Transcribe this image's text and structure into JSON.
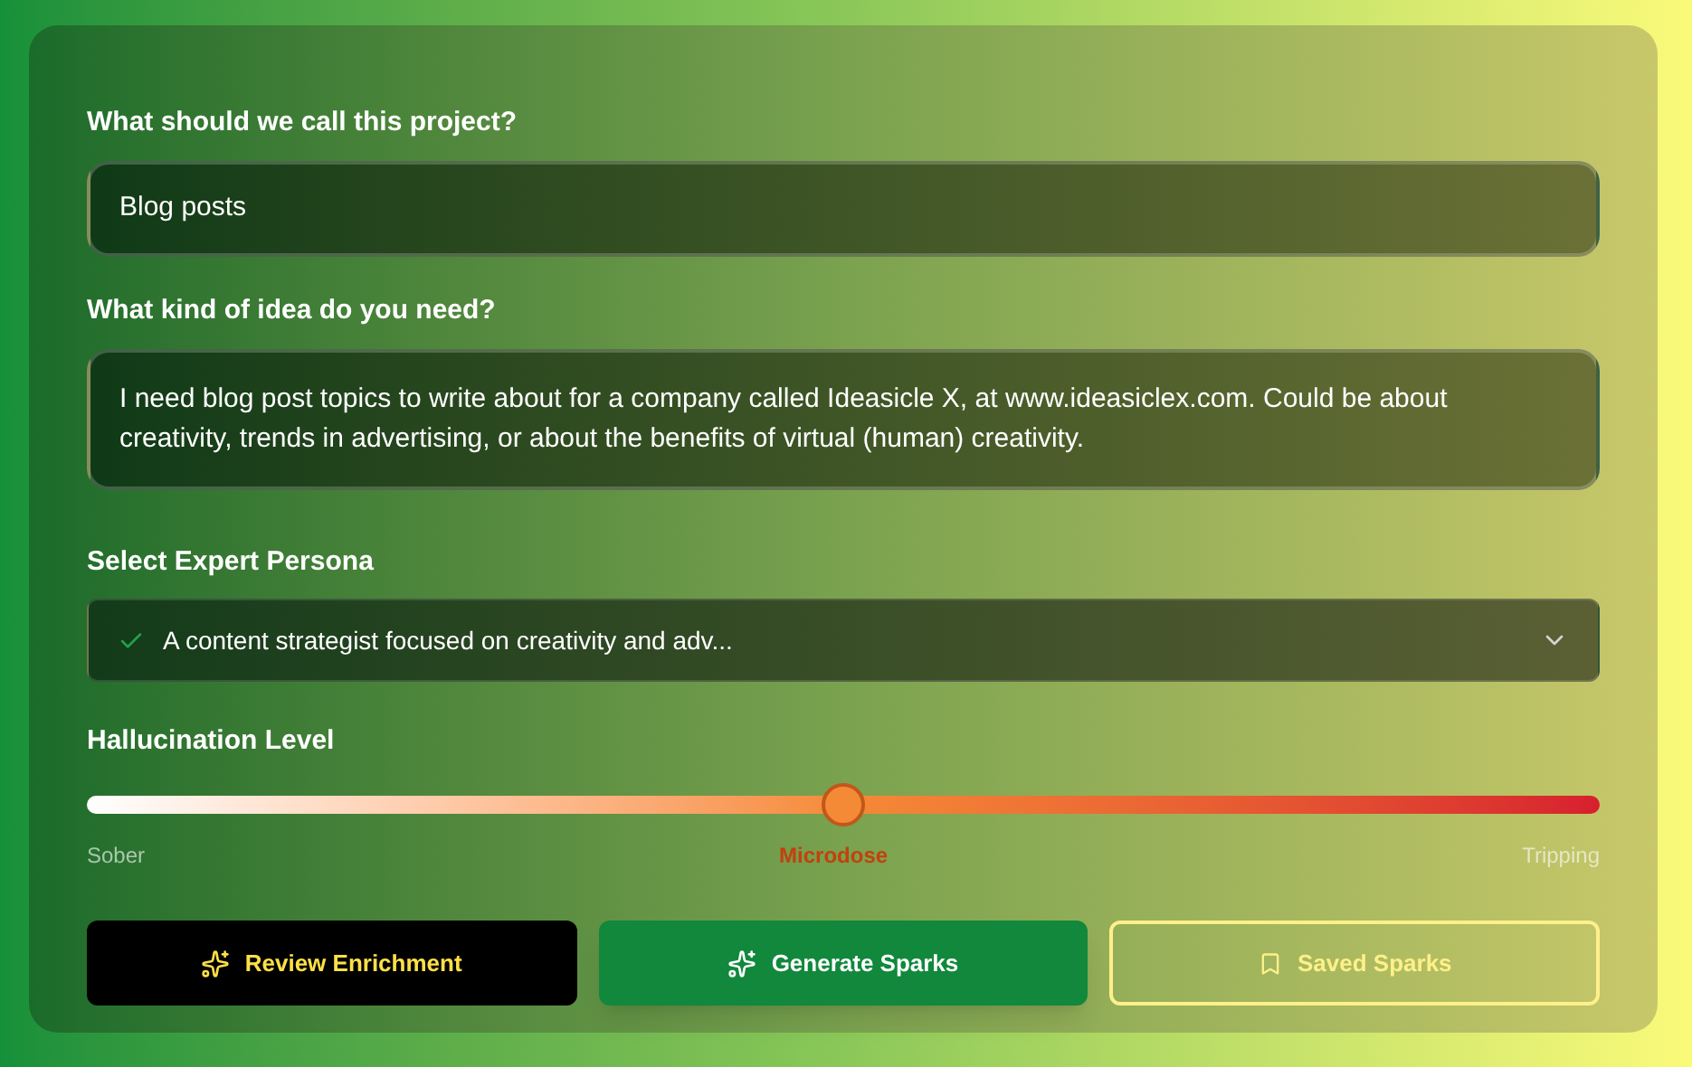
{
  "project": {
    "label": "What should we call this project?",
    "value": "Blog posts"
  },
  "idea": {
    "label": "What kind of idea do you need?",
    "value": "I need blog post topics to write about for a company called Ideasicle X, at www.ideasiclex.com. Could be about creativity, trends in advertising, or about the benefits of virtual (human) creativity."
  },
  "persona": {
    "label": "Select Expert Persona",
    "value": "A content strategist focused on creativity and adv..."
  },
  "hallucination": {
    "label": "Hallucination Level",
    "level": 0.5,
    "stops": [
      {
        "label": "Sober",
        "selected": false
      },
      {
        "label": "Microdose",
        "selected": true
      },
      {
        "label": "Tripping",
        "selected": false
      }
    ]
  },
  "buttons": [
    {
      "label": "Review Enrichment",
      "kind": "dark"
    },
    {
      "label": "Generate Sparks",
      "kind": "primary"
    },
    {
      "label": "Saved Sparks",
      "kind": "outline"
    }
  ]
}
